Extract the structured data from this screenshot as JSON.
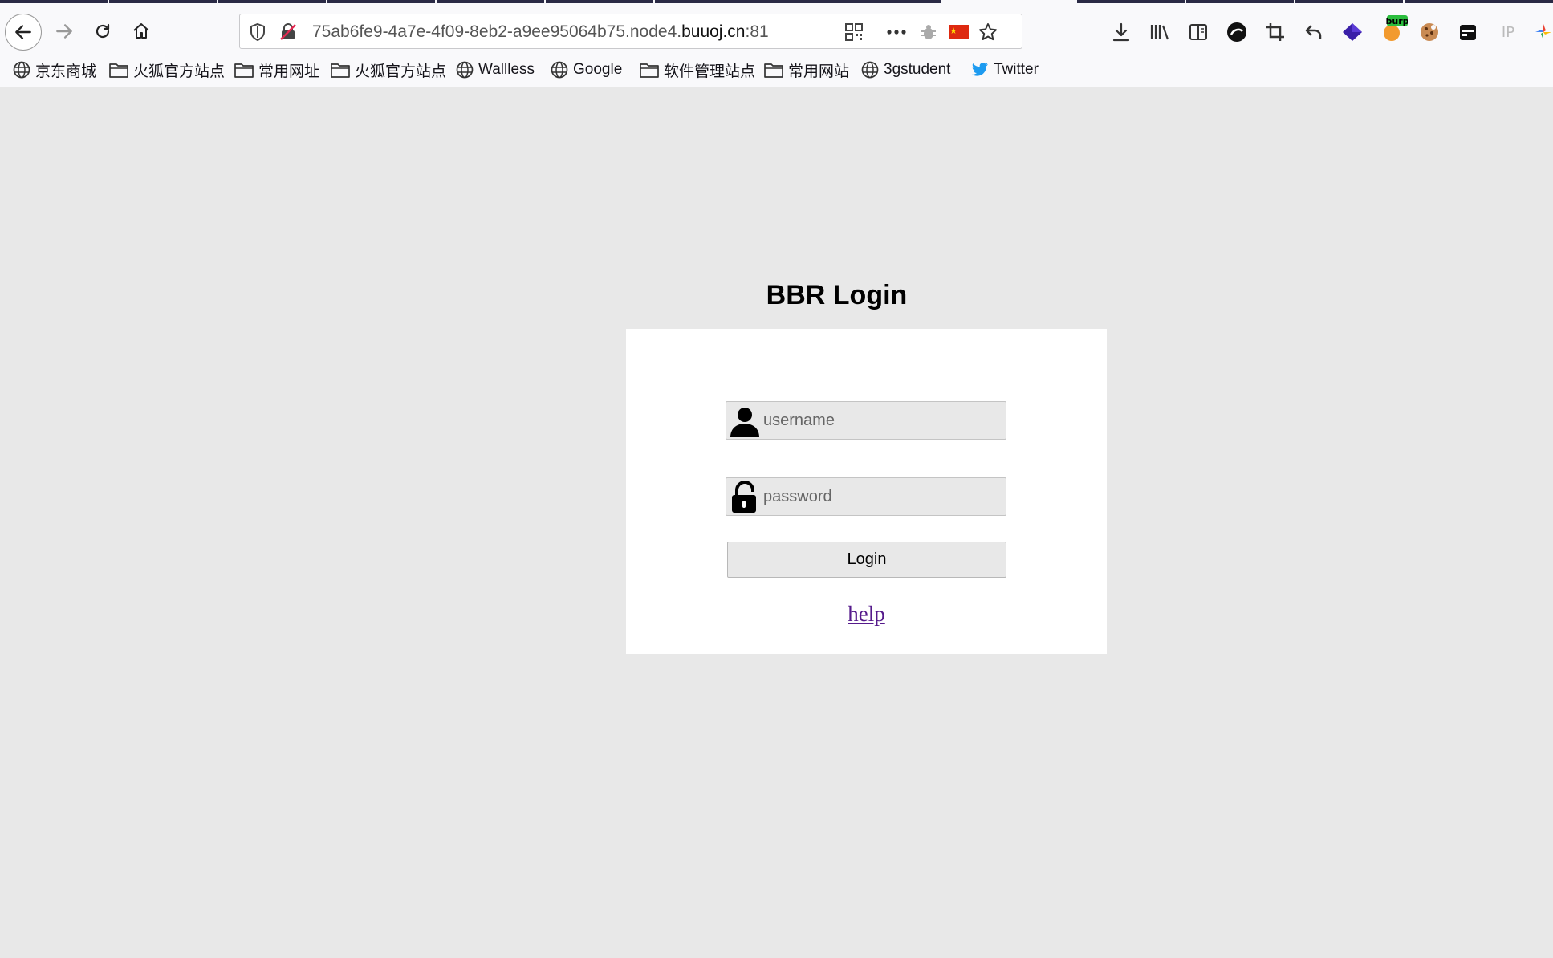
{
  "browser": {
    "url_prefix": "75ab6fe9-4a7e-4f09-8eb2-a9ee95064b75.node4.",
    "url_domain": "buuoj.cn",
    "url_suffix": ":81",
    "toolbar_icons": [
      "download-icon",
      "library-icon",
      "sidebar-icon",
      "extension-dark-icon",
      "crop-icon",
      "undo-icon",
      "layers-icon",
      "burp-icon",
      "cookie-icon",
      "calendar-icon",
      "ip-icon",
      "more-icon"
    ],
    "burp_label": "burp",
    "ip_label": "IP"
  },
  "bookmarks": [
    {
      "label": "京东商城",
      "icon": "globe-icon"
    },
    {
      "label": "火狐官方站点",
      "icon": "folder-icon"
    },
    {
      "label": "常用网址",
      "icon": "folder-icon"
    },
    {
      "label": "火狐官方站点",
      "icon": "folder-icon"
    },
    {
      "label": "Wallless",
      "icon": "globe-icon"
    },
    {
      "label": "Google",
      "icon": "globe-icon"
    },
    {
      "label": "软件管理站点",
      "icon": "folder-icon"
    },
    {
      "label": "常用网站",
      "icon": "folder-icon"
    },
    {
      "label": "3gstudent",
      "icon": "globe-icon"
    },
    {
      "label": "Twitter",
      "icon": "twitter-icon"
    }
  ],
  "login": {
    "title": "BBR Login",
    "username_placeholder": "username",
    "password_placeholder": "password",
    "button_label": "Login",
    "help_link": "help"
  },
  "colors": {
    "page_bg": "#e8e8e8",
    "card_bg": "#ffffff",
    "link": "#551a8b",
    "twitter": "#1d9bf0"
  }
}
